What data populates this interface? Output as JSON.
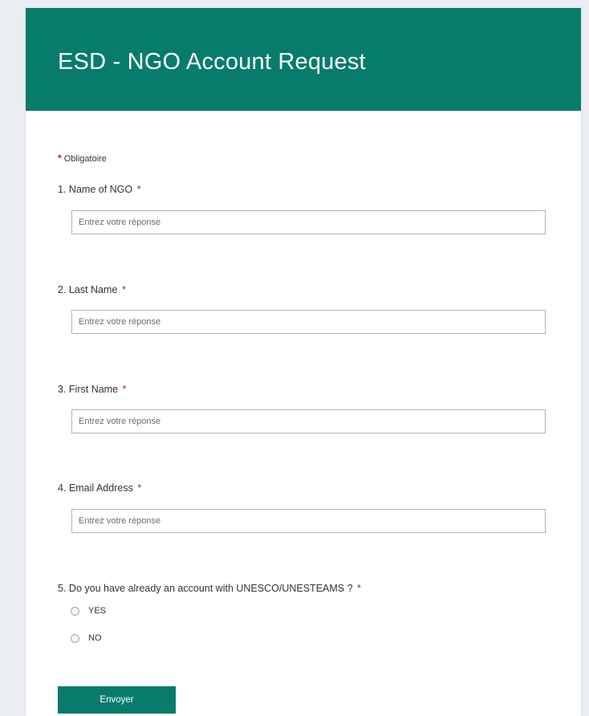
{
  "header": {
    "title": "ESD - NGO Account Request"
  },
  "required_note": {
    "asterisk": "*",
    "label": "Obligatoire"
  },
  "questions": [
    {
      "number": "1.",
      "label": "Name of NGO",
      "asterisk": "*",
      "placeholder": "Entrez votre réponse",
      "value": ""
    },
    {
      "number": "2.",
      "label": "Last Name",
      "asterisk": "*",
      "placeholder": "Entrez votre réponse",
      "value": ""
    },
    {
      "number": "3.",
      "label": "First Name",
      "asterisk": "*",
      "placeholder": "Entrez votre réponse",
      "value": ""
    },
    {
      "number": "4.",
      "label": "Email Address",
      "asterisk": "*",
      "placeholder": "Entrez votre réponse",
      "value": ""
    },
    {
      "number": "5.",
      "label": "Do you have already an account with UNESCO/UNESTEAMS ?",
      "asterisk": "*",
      "options": [
        "YES",
        "NO"
      ],
      "selected": null
    }
  ],
  "submit": {
    "label": "Envoyer"
  },
  "colors": {
    "accent": "#077c6b",
    "required": "#a4262c",
    "page_background": "#eaeef2"
  }
}
